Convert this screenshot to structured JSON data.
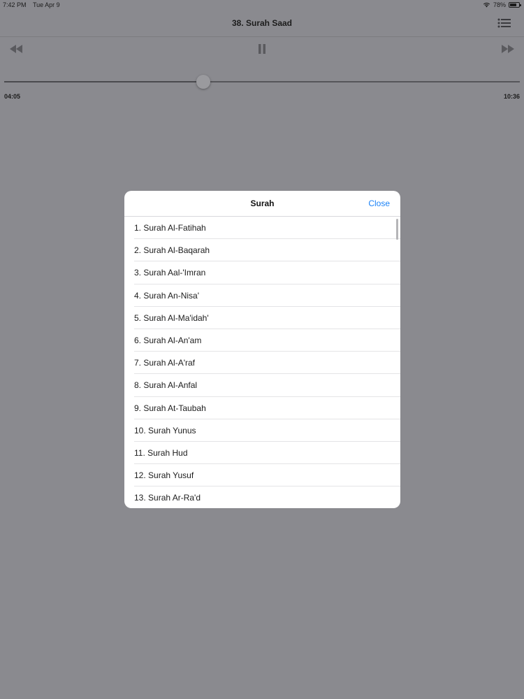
{
  "status_bar": {
    "time": "7:42 PM",
    "date": "Tue Apr 9",
    "battery": "78%",
    "battery_level": 0.78
  },
  "nav": {
    "title": "38. Surah Saad",
    "list_icon": "list-icon"
  },
  "player": {
    "rewind_icon": "rewind-icon",
    "pause_icon": "pause-icon",
    "forward_icon": "fast-forward-icon",
    "elapsed": "04:05",
    "total": "10:36",
    "progress": 0.386
  },
  "modal": {
    "title": "Surah",
    "close_label": "Close",
    "items": [
      "1. Surah Al-Fatihah",
      "2. Surah Al-Baqarah",
      "3. Surah Aal-'Imran",
      "4. Surah An-Nisa'",
      "5. Surah Al-Ma'idah'",
      "6. Surah Al-An'am",
      "7. Surah Al-A'raf",
      "8. Surah Al-Anfal",
      "9. Surah At-Taubah",
      "10. Surah Yunus",
      "11. Surah Hud",
      "12. Surah Yusuf",
      "13. Surah Ar-Ra'd"
    ]
  },
  "colors": {
    "accent": "#1a82f7",
    "dim_background": "#8a8a8f",
    "modal_background": "#ffffff"
  }
}
